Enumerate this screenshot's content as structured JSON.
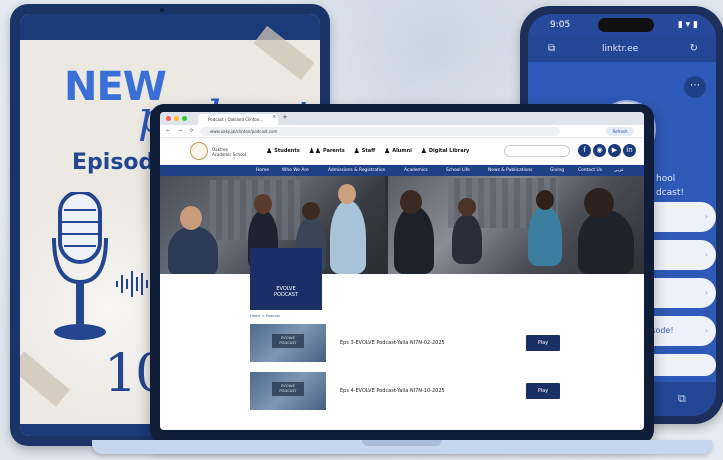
{
  "tablet_poster": {
    "headline": "NEW",
    "script_word": "podcast",
    "episode_label": "Episode",
    "episode_number": "10"
  },
  "phone": {
    "status_time": "9:05",
    "status_icons": "▮ ▾ ▮",
    "url_domain": "linktr.ee",
    "bio_lines": [
      "hool",
      "dcast!"
    ],
    "links": [
      "",
      "",
      "",
      "rsode!",
      ""
    ],
    "more_icon": "⋯"
  },
  "browser": {
    "tab_title": "Podcast | Oakland Clinton...",
    "tab_close": "×",
    "tab_add": "+",
    "address": "www.oaky.jal/clinton/podcast.com",
    "nav_icons": "← → ⟳",
    "refresh_button": "Refresh"
  },
  "site": {
    "school_name": "Oaktree Academic School",
    "top_links": [
      "Students",
      "Parents",
      "Staff",
      "Alumni",
      "Digital Library"
    ],
    "social_icons": [
      "f",
      "◉",
      "▶",
      "in"
    ],
    "nav_items": [
      "Home",
      "Who We Are",
      "Admissions & Registration",
      "Academics",
      "School Life",
      "News & Publications",
      "Giving",
      "Contact Us",
      "عربي"
    ],
    "hero_box_lines": [
      "EVOLVE",
      "PODCAST"
    ],
    "breadcrumb": "Home > Podcast",
    "episodes": [
      {
        "thumb_label": "EVOLVE PODCAST",
        "title": "Eps 3-EVOLVE Podcast-Yalla NI7N-02-2025",
        "play_label": "Play"
      },
      {
        "thumb_label": "EVOLVE PODCAST",
        "title": "Eps 4-EVOLVE Podcast-Yalla NI7N-10-2025",
        "play_label": "Play"
      }
    ]
  },
  "colors": {
    "navy": "#1a2f66",
    "nav_blue": "#1f3f86",
    "phone_blue": "#2f59b8",
    "poster_blue": "#3b6fd8"
  }
}
